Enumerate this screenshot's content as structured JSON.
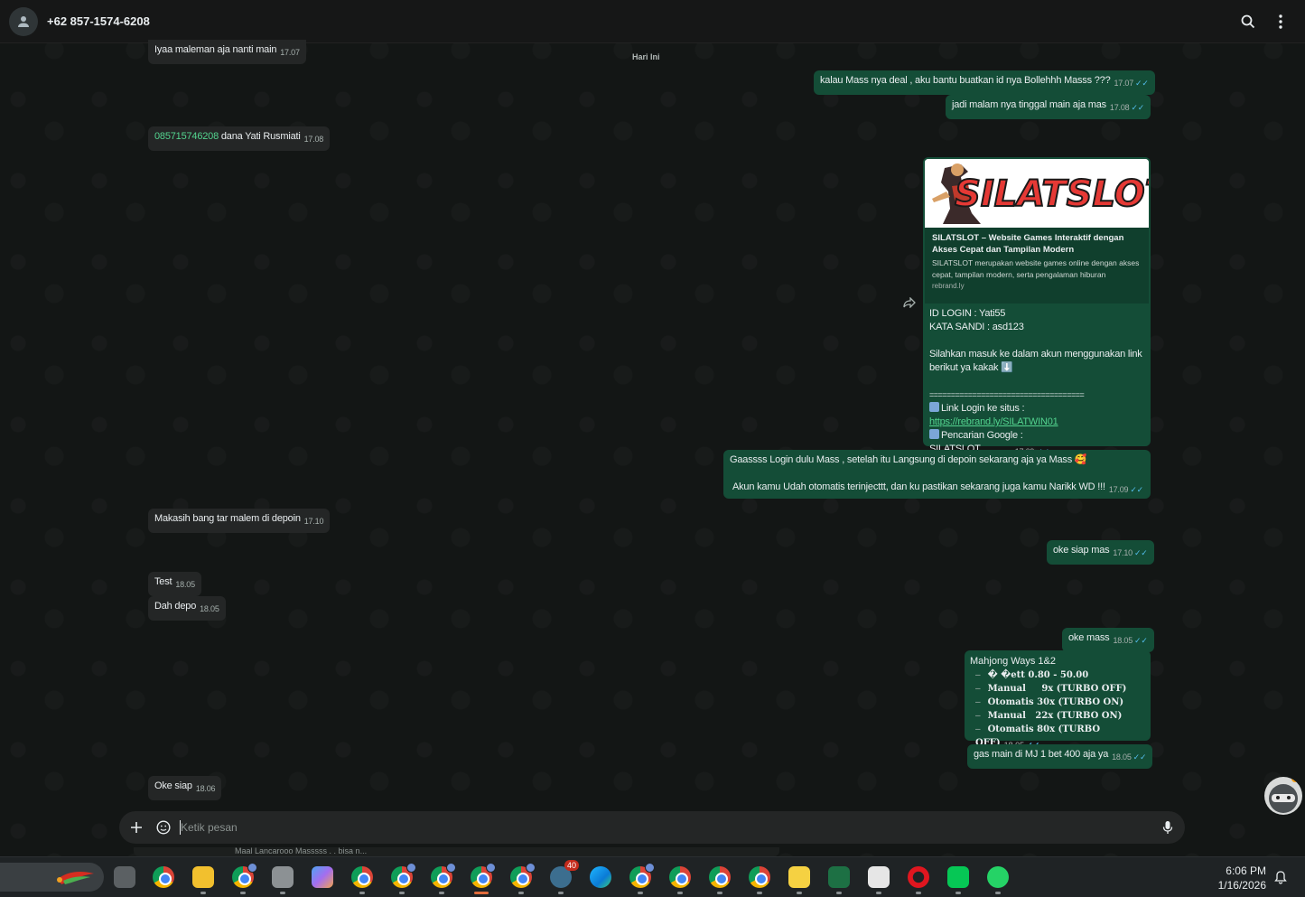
{
  "header": {
    "contact": "+62 857-1574-6208"
  },
  "date_divider": "Hari Ini",
  "messages": {
    "m1": {
      "text": "Iyaa maleman aja nanti main",
      "time": "17.07"
    },
    "m2": {
      "text": "kalau Mass nya deal , aku bantu buatkan id nya Bollehhh Masss ???",
      "time": "17.07"
    },
    "m3": {
      "text": "jadi malam nya tinggal main aja mas",
      "time": "17.08"
    },
    "m4": {
      "number": "085715746208",
      "text": " dana Yati Rusmiati",
      "time": "17.08"
    },
    "m6": {
      "line1": "Gaassss Login dulu Mass  , setelah itu Langsung di depoin sekarang aja ya Mass 🥰",
      "line2": "Akun kamu Udah otomatis terinjecttt, dan ku pastikan sekarang juga kamu Narikk WD !!!",
      "time": "17.09"
    },
    "m7": {
      "text": "Makasih bang tar malem di depoin",
      "time": "17.10"
    },
    "m8": {
      "text": "oke siap mas",
      "time": "17.10"
    },
    "m9": {
      "text": "Test",
      "time": "18.05"
    },
    "m10": {
      "text": "Dah depo",
      "time": "18.05"
    },
    "m11": {
      "text": "oke mass",
      "time": "18.05"
    },
    "m13": {
      "text": "gas main di MJ 1 bet 400 aja ya",
      "time": "18.05"
    },
    "m14": {
      "text": "Oke siap",
      "time": "18.06"
    }
  },
  "card": {
    "logo_text": "SILATSLOT",
    "preview_title": "SILATSLOT – Website Games Interaktif dengan Akses Cepat dan Tampilan Modern",
    "preview_desc": "SILATSLOT merupakan website games online dengan akses cepat, tampilan modern, serta pengalaman hiburan",
    "preview_domain": "rebrand.ly",
    "id_login": "ID LOGIN : Yati55",
    "kata_sandi": "KATA SANDI : asd123",
    "instruction": "Silahkan masuk ke dalam akun menggunakan link berikut ya kakak ⬇️",
    "separator": "====================================",
    "link_label": "Link Login ke situs  :",
    "link_url": "https://rebrand.ly/SILATWIN01",
    "google_label": "Pencarian Google : SILATSLOT",
    "time": "17.09"
  },
  "mahjong": {
    "title": "Mahjong Ways 1&2",
    "rows": [
      "� �ett 0.80 - 50.00",
      "Manual     9x (TURBO OFF)",
      "Otomatis 30x (TURBO ON)",
      "Manual   22x (TURBO ON)",
      "Otomatis 80x (TURBO OFF)"
    ],
    "time": "18.05"
  },
  "composer": {
    "placeholder": "Ketik pesan",
    "peek": "Maal Lancarooo Masssss . . bisa n..."
  },
  "taskbar": {
    "time": "6:06 PM",
    "date": "1/16/2026",
    "badge": "40"
  }
}
